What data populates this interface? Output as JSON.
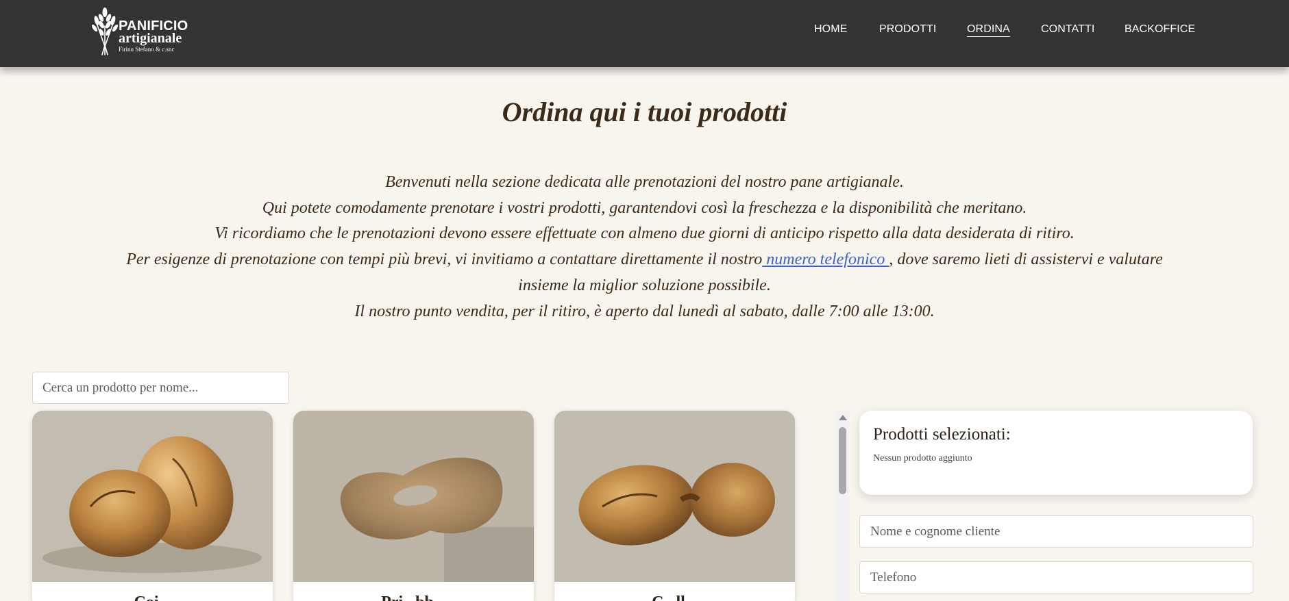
{
  "header": {
    "logo": {
      "title": "PANIFICIO",
      "subtitle": "artigianale",
      "owner": "Firinu Stefano & c.snc"
    },
    "nav": [
      {
        "label": "HOME",
        "active": false
      },
      {
        "label": "PRODOTTI",
        "active": false
      },
      {
        "label": "ORDINA",
        "active": true
      },
      {
        "label": "CONTATTI",
        "active": false
      },
      {
        "label": "BACKOFFICE",
        "active": false
      }
    ]
  },
  "main": {
    "title": "Ordina qui i tuoi prodotti",
    "intro": {
      "line1": "Benvenuti nella sezione dedicata alle prenotazioni del nostro pane artigianale.",
      "line2": "Qui potete comodamente prenotare i vostri prodotti, garantendovi così la freschezza e la disponibilità che meritano.",
      "line3": "Vi ricordiamo che le prenotazioni devono essere effettuate con almeno due giorni di anticipo rispetto alla data desiderata di ritiro.",
      "line4_before": "Per esigenze di prenotazione con tempi più brevi, vi invitiamo a contattare direttamente il nostro",
      "phone_link": " numero telefonico ",
      "line4_after": ", dove saremo lieti di assistervi e valutare insieme la miglior soluzione possibile.",
      "line5": "Il nostro punto vendita, per il ritiro, è aperto dal lunedì al sabato, dalle 7:00 alle 13:00."
    },
    "search": {
      "placeholder": "Cerca un prodotto per nome..."
    },
    "products": [
      {
        "name": "Coi...",
        "image": "bread-loaves"
      },
      {
        "name": "Pri...bb...",
        "image": "bread-ring"
      },
      {
        "name": "C...ll...",
        "image": "bread-twist"
      }
    ]
  },
  "order_panel": {
    "title": "Prodotti selezionati:",
    "empty_message": "Nessun prodotto aggiunto",
    "name_placeholder": "Nome e cognome cliente",
    "phone_placeholder": "Telefono"
  },
  "colors": {
    "header_bg": "#333333",
    "page_bg": "#f8f4ee",
    "text": "#3b2a17",
    "link": "#3a62c8"
  }
}
